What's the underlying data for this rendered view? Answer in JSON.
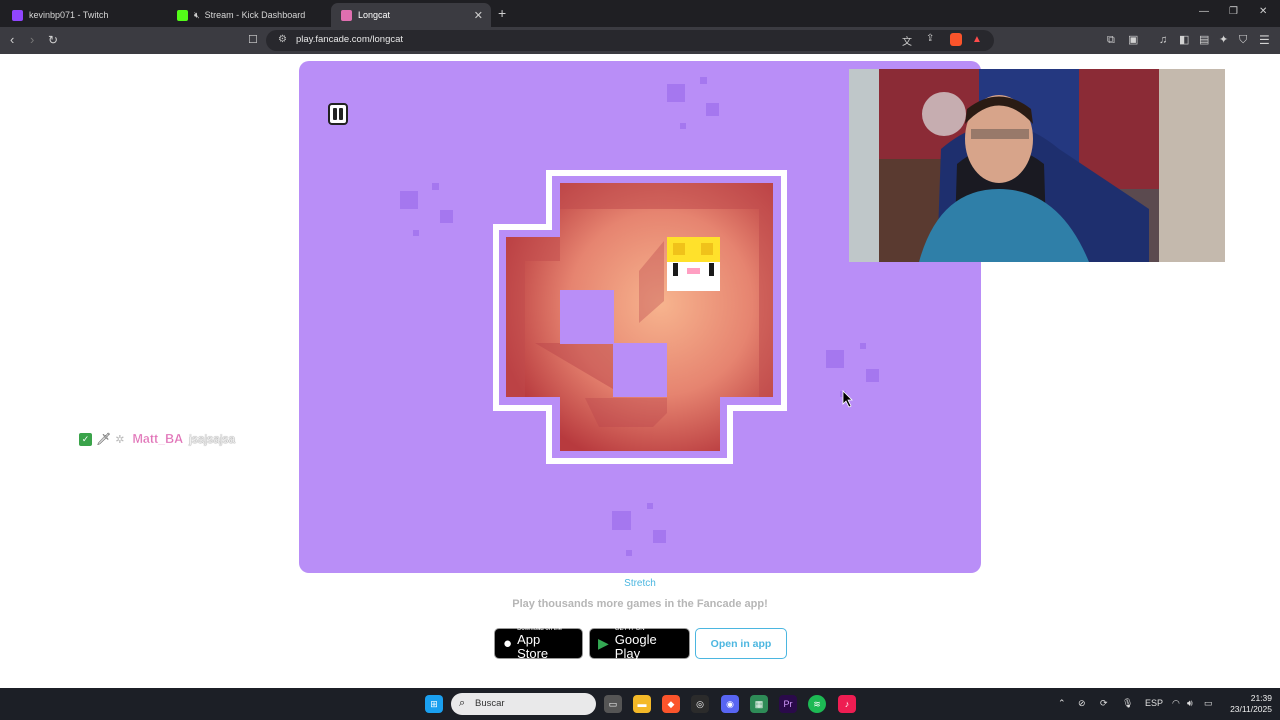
{
  "browser": {
    "tabs": [
      {
        "title": "kevinbp071 - Twitch",
        "favicon_color": "#9146ff"
      },
      {
        "title": "Stream - Kick Dashboard",
        "favicon_color": "#53fc18"
      },
      {
        "title": "Longcat",
        "favicon_color": "#e06fb0",
        "active": true
      }
    ],
    "url": "play.fancade.com/longcat",
    "new_tab_symbol": "+",
    "window_controls": [
      "—",
      "❐",
      "✕"
    ]
  },
  "game": {
    "background_color": "#b98ef7",
    "board_color": "#e8806f"
  },
  "chat_overlay": {
    "username": "Matt_BA",
    "message": "jsajsajsa"
  },
  "page": {
    "stretch_label": "Stretch",
    "promo_text": "Play thousands more games in the Fancade app!",
    "app_store": {
      "small": "Download on the",
      "big": "App Store"
    },
    "google_play": {
      "small": "GET IT ON",
      "big": "Google Play"
    },
    "open_in_app": "Open in app"
  },
  "taskbar": {
    "search_placeholder": "Buscar",
    "language": "ESP",
    "time": "21:39",
    "date": "23/11/2025"
  }
}
